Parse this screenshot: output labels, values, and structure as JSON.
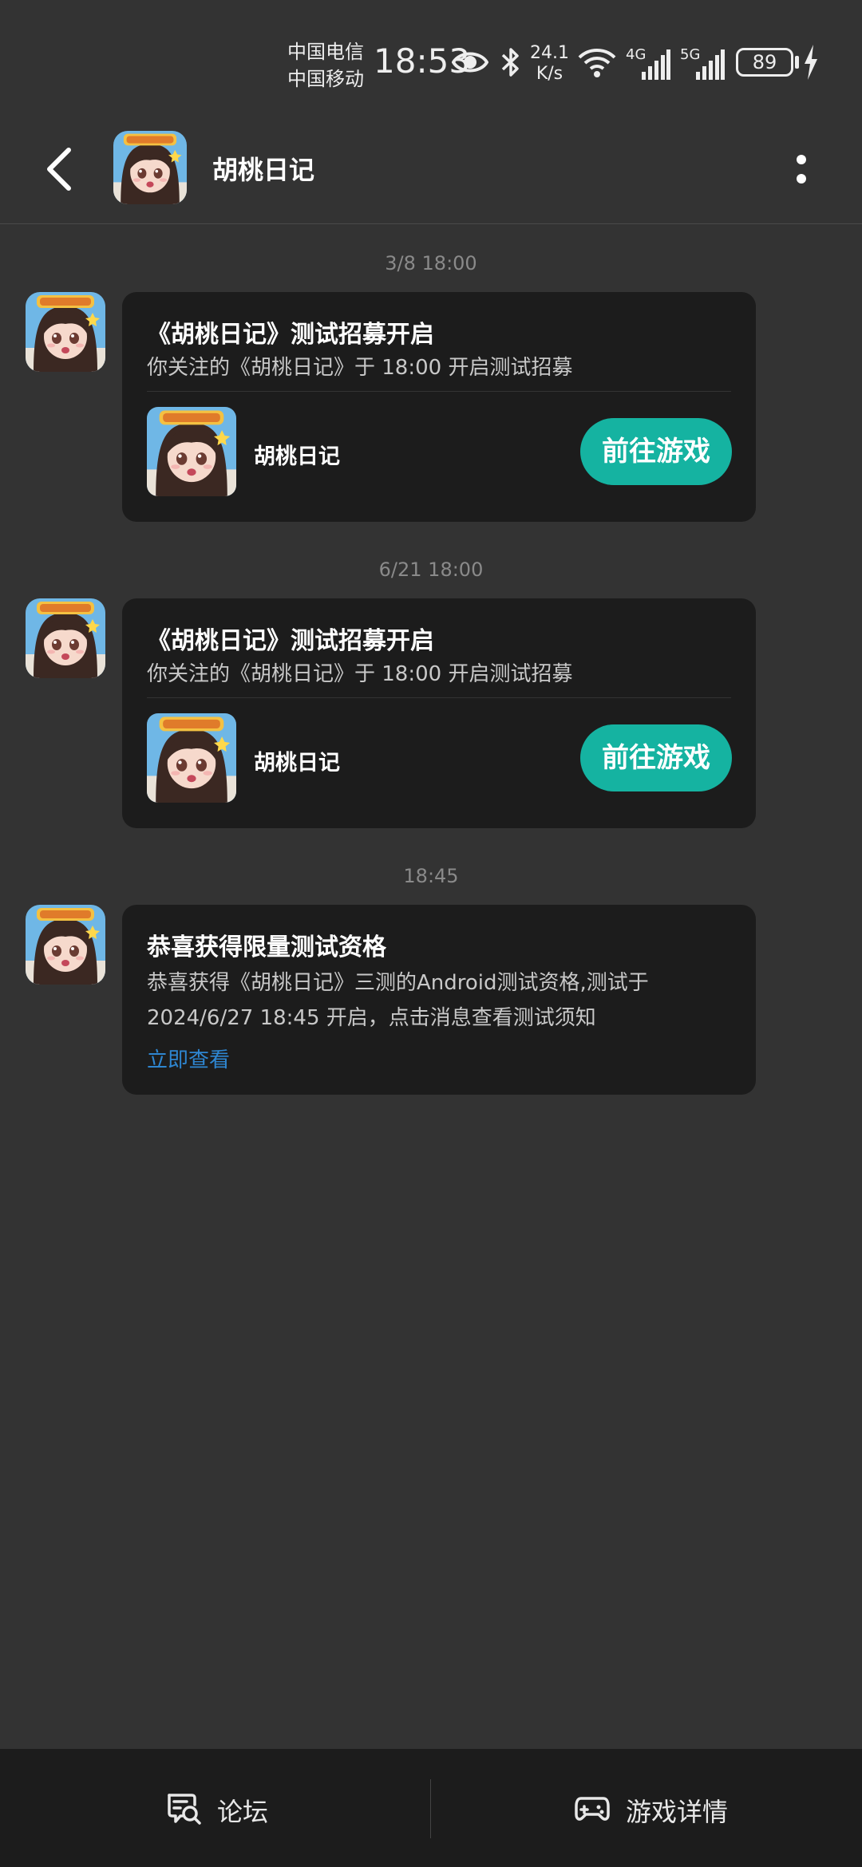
{
  "status_bar": {
    "carrier_1": "中国电信",
    "carrier_2": "中国移动",
    "time": "18:53",
    "net_speed_value": "24.1",
    "net_speed_unit": "K/s",
    "sim1_type": "4G",
    "sim2_type": "5G",
    "battery": "89"
  },
  "header": {
    "title": "胡桃日记",
    "back_icon": "back-arrow-icon",
    "more_icon": "more-vertical-icon"
  },
  "messages": [
    {
      "timestamp": "3/8  18:00",
      "title": "《胡桃日记》测试招募开启",
      "description": "你关注的《胡桃日记》于 18:00 开启测试招募",
      "game_name": "胡桃日记",
      "button_label": "前往游戏"
    },
    {
      "timestamp": "6/21  18:00",
      "title": "《胡桃日记》测试招募开启",
      "description": "你关注的《胡桃日记》于 18:00 开启测试招募",
      "game_name": "胡桃日记",
      "button_label": "前往游戏"
    },
    {
      "timestamp": "18:45",
      "title": "恭喜获得限量测试资格",
      "description": "恭喜获得《胡桃日记》三测的Android测试资格,测试于 2024/6/27 18:45 开启，点击消息查看测试须知",
      "link_label": "立即查看"
    }
  ],
  "bottom_nav": {
    "forum_label": "论坛",
    "forum_icon": "forum-chat-icon",
    "details_label": "游戏详情",
    "details_icon": "gamepad-icon"
  },
  "colors": {
    "background": "#333333",
    "card": "#1c1c1c",
    "accent_button": "#15b3a1",
    "link": "#2e86d1"
  }
}
